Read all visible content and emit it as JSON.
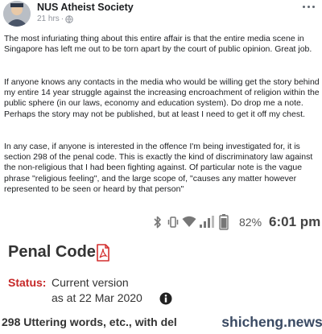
{
  "post": {
    "author": "NUS Atheist Society",
    "time": "21 hrs",
    "separator": "·",
    "paragraphs": [
      "The most infuriating thing about this entire affair is that the entire media scene in Singapore has left me out to be torn apart by the court of public opinion. Great job.",
      "If anyone knows any contacts in the media who would be willing get the story behind my entire 14 year struggle against the increasing encroachment of religion within the public sphere (in our laws, economy and education system). Do drop me a note. Perhaps the story may not be published, but at least I need to get it off my chest.",
      "In any case, if anyone is interested in the offence I'm being investigated for, it is section 298 of the penal code. This is exactly the kind of discriminatory law against the non-religious that I had been fighting against. Of particular note is the vague phrase \"religious feeling\", and the large scope of, \"causes any matter however represented to be seen or heard by that person\""
    ]
  },
  "phone": {
    "status_bar": {
      "battery": "82%",
      "time": "6:01 pm"
    },
    "document": {
      "title": "Penal Code",
      "status_label": "Status:",
      "status_value": "Current version",
      "status_date": "as at 22 Mar 2020",
      "section_heading": "298 Uttering words, etc., with del"
    }
  },
  "watermark": "shicheng.news",
  "icons": {
    "globe": "globe-icon",
    "more": "more-options-icon",
    "bluetooth": "bluetooth-icon",
    "vibrate": "vibrate-icon",
    "wifi": "wifi-icon",
    "signal": "signal-icon",
    "battery": "battery-icon",
    "pdf": "pdf-icon",
    "info": "info-icon"
  },
  "colors": {
    "status_label": "#c62828",
    "pdf_icon": "#d32f2f",
    "watermark_text": "#3a4a63"
  }
}
